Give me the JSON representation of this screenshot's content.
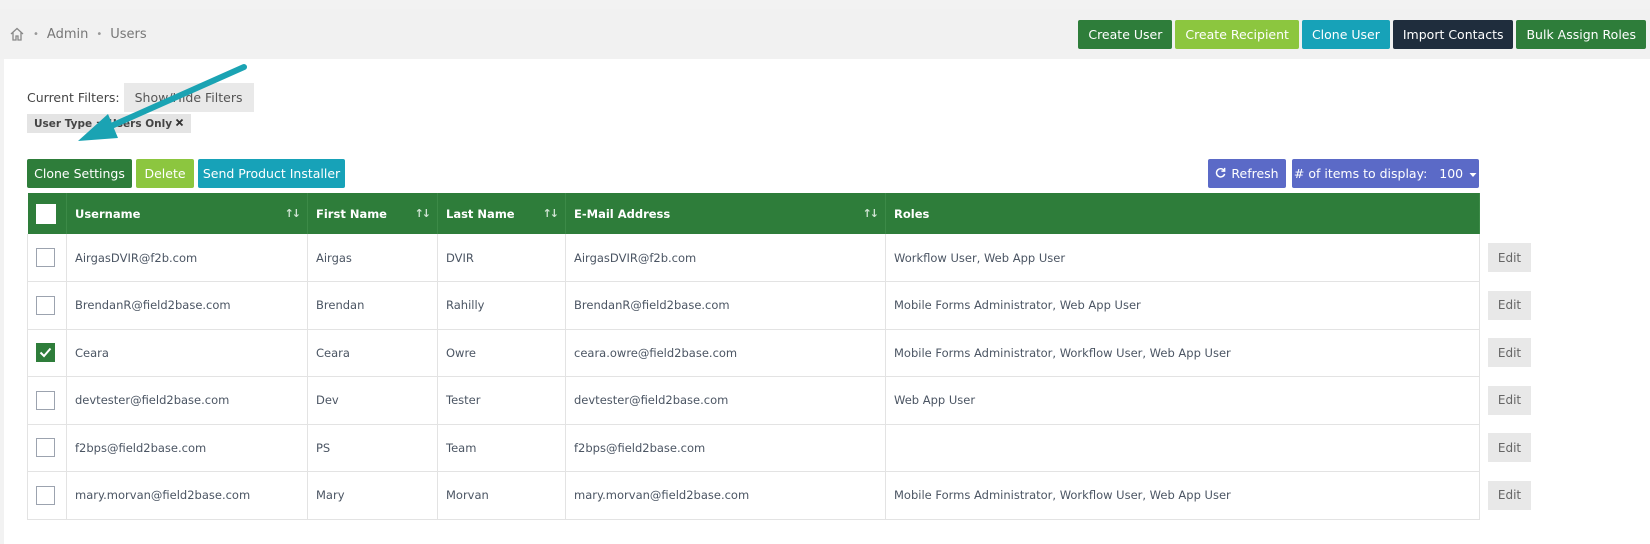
{
  "breadcrumb": {
    "home_icon": "home-icon",
    "items": [
      "Admin",
      "Users"
    ]
  },
  "header_actions": [
    {
      "label": "Create User",
      "color": "#2e7d3a"
    },
    {
      "label": "Create Recipient",
      "color": "#8cc63f"
    },
    {
      "label": "Clone User",
      "color": "#17a2b8"
    },
    {
      "label": "Import Contacts",
      "color": "#1f2d3d"
    },
    {
      "label": "Bulk Assign Roles",
      "color": "#2e7d3a"
    }
  ],
  "filters": {
    "label": "Current Filters:",
    "toggle_label": "Show/Hide Filters",
    "chips": [
      {
        "label": "User Type = Users Only",
        "remove_icon": "close-icon"
      }
    ]
  },
  "toolbar": {
    "clone_settings": "Clone Settings",
    "delete": "Delete",
    "send_installer": "Send Product Installer",
    "refresh": "Refresh",
    "refresh_icon": "refresh-icon",
    "items_display_label": "# of items to display:",
    "items_display_value": "100"
  },
  "colors": {
    "green": "#2e7d3a",
    "lime": "#8cc63f",
    "teal": "#17a2b8",
    "navy": "#1f2d3d",
    "purple": "#5b6ac7",
    "annotation_arrow": "#1aa3b3"
  },
  "table": {
    "columns": [
      "Username",
      "First Name",
      "Last Name",
      "E-Mail Address",
      "Roles"
    ],
    "edit_label": "Edit",
    "rows": [
      {
        "checked": false,
        "username": "AirgasDVIR@f2b.com",
        "first": "Airgas",
        "last": "DVIR",
        "email": "AirgasDVIR@f2b.com",
        "roles": "Workflow User, Web App User"
      },
      {
        "checked": false,
        "username": "BrendanR@field2base.com",
        "first": "Brendan",
        "last": "Rahilly",
        "email": "BrendanR@field2base.com",
        "roles": "Mobile Forms Administrator, Web App User"
      },
      {
        "checked": true,
        "username": "Ceara",
        "first": "Ceara",
        "last": "Owre",
        "email": "ceara.owre@field2base.com",
        "roles": "Mobile Forms Administrator, Workflow User, Web App User"
      },
      {
        "checked": false,
        "username": "devtester@field2base.com",
        "first": "Dev",
        "last": "Tester",
        "email": "devtester@field2base.com",
        "roles": "Web App User"
      },
      {
        "checked": false,
        "username": "f2bps@field2base.com",
        "first": "PS",
        "last": "Team",
        "email": "f2bps@field2base.com",
        "roles": ""
      },
      {
        "checked": false,
        "username": "mary.morvan@field2base.com",
        "first": "Mary",
        "last": "Morvan",
        "email": "mary.morvan@field2base.com",
        "roles": "Mobile Forms Administrator, Workflow User, Web App User"
      }
    ]
  }
}
